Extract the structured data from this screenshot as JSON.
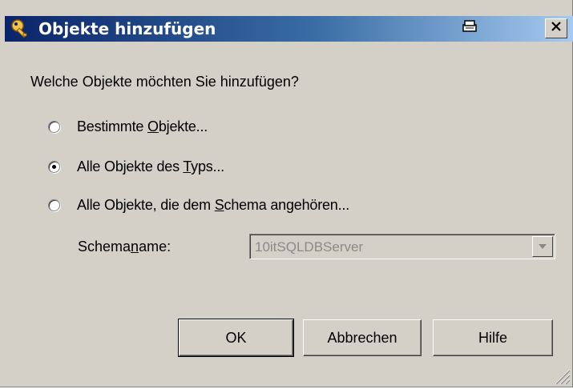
{
  "window": {
    "title": "Objekte hinzufügen",
    "title_icon": "key-icon",
    "print_icon": "print-icon",
    "close_label": "✕"
  },
  "question": "Welche Objekte möchten Sie hinzufügen?",
  "options": [
    {
      "pre": "Bestimmte ",
      "accel": "O",
      "post": "bjekte...",
      "checked": false
    },
    {
      "pre": "Alle Objekte des ",
      "accel": "T",
      "post": "yps...",
      "checked": true
    },
    {
      "pre": "Alle Objekte, die dem ",
      "accel": "S",
      "post": "chema angehören...",
      "checked": false
    }
  ],
  "schema": {
    "label_pre": "Schema",
    "label_accel": "n",
    "label_post": "ame:",
    "value": "10itSQLDBServer",
    "enabled": false
  },
  "buttons": {
    "ok": "OK",
    "cancel": "Abbrechen",
    "help": "Hilfe"
  },
  "colors": {
    "dialog_bg": "#d4d0c8",
    "title_start": "#0a246a",
    "title_end": "#a6caf0"
  }
}
